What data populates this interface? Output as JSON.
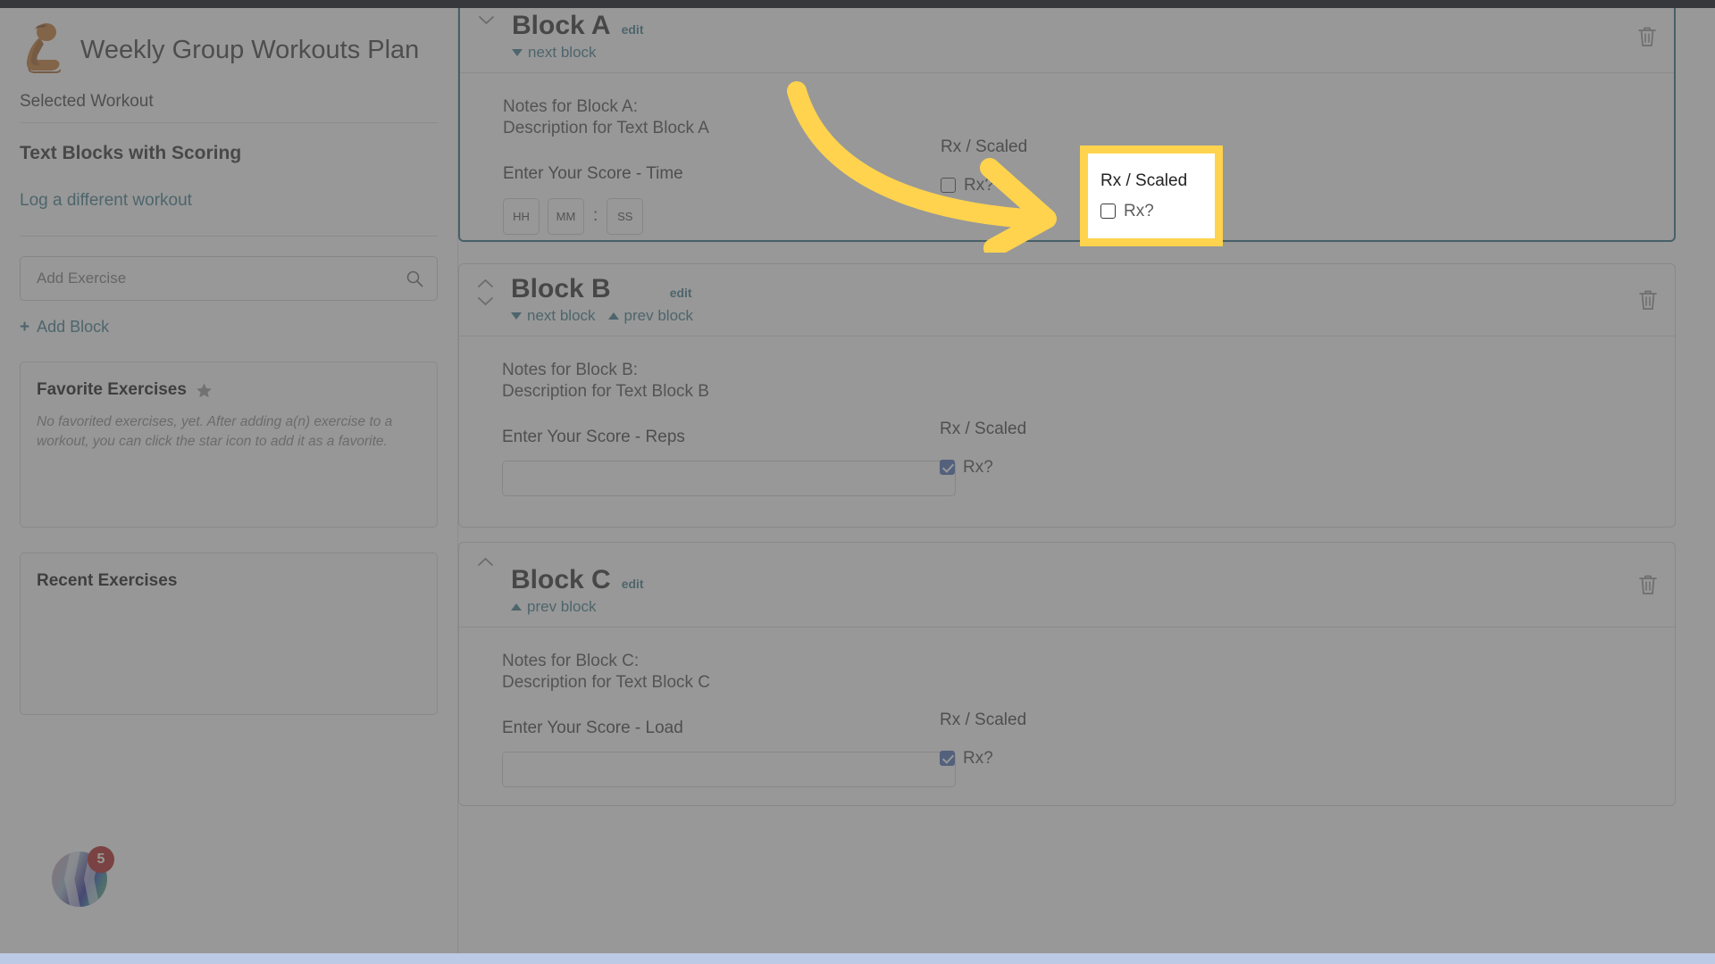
{
  "app": {
    "brand_title": "Weekly Group Workouts Plan",
    "logo_icon": "kneeling-athlete-logo"
  },
  "sidebar": {
    "selected_workout_label": "Selected Workout",
    "workout_name": "Text Blocks with Scoring",
    "log_different_link": "Log a different workout",
    "add_exercise": {
      "placeholder": "Add Exercise",
      "value": "",
      "icon": "search-icon"
    },
    "add_block_link": "Add Block",
    "add_block_icon": "plus-icon",
    "favorites": {
      "title": "Favorite Exercises",
      "icon": "star-icon",
      "empty_text": "No favorited exercises, yet. After adding a(n) exercise to a workout, you can click the star icon to add it as a favorite."
    },
    "recent": {
      "title": "Recent Exercises"
    },
    "float_widget": {
      "badge_count": "5",
      "icon": "wave-logo-icon"
    }
  },
  "main": {
    "blocks": [
      {
        "title": "Block A",
        "edit_label": "edit",
        "next_label": "next block",
        "prev_label": "",
        "notes_label": "Notes for Block A:",
        "notes_text": "Description for Text Block A",
        "score_label": "Enter Your Score - Time",
        "score_type": "time",
        "time_fields": {
          "hh": "HH",
          "mm": "MM",
          "ss": "SS",
          "separator": ":"
        },
        "score_value": "",
        "rx_title": "Rx / Scaled",
        "rx_label": "Rx?",
        "rx_checked": false,
        "delete_icon": "trash-icon",
        "active": true,
        "chevrons": [
          "down"
        ]
      },
      {
        "title": "Block B",
        "edit_label": "edit",
        "next_label": "next block",
        "prev_label": "prev block",
        "notes_label": "Notes for Block B:",
        "notes_text": "Description for Text Block B",
        "score_label": "Enter Your Score - Reps",
        "score_type": "text",
        "score_value": "",
        "rx_title": "Rx / Scaled",
        "rx_label": "Rx?",
        "rx_checked": true,
        "delete_icon": "trash-icon",
        "active": false,
        "chevrons": [
          "up",
          "down"
        ]
      },
      {
        "title": "Block C",
        "edit_label": "edit",
        "next_label": "",
        "prev_label": "prev block",
        "notes_label": "Notes for Block C:",
        "notes_text": "Description for Text Block C",
        "score_label": "Enter Your Score - Load",
        "score_type": "text",
        "score_value": "",
        "rx_title": "Rx / Scaled",
        "rx_label": "Rx?",
        "rx_checked": true,
        "delete_icon": "trash-icon",
        "active": false,
        "chevrons": [
          "up"
        ]
      }
    ]
  },
  "annotation": {
    "highlight": {
      "title": "Rx / Scaled",
      "checkbox_label": "Rx?",
      "checked": false,
      "border_color": "#ffd34e",
      "background": "#ffffff"
    },
    "arrow": {
      "icon": "curved-arrow-icon",
      "color": "#ffd34e"
    }
  },
  "colors": {
    "link": "#3b7a8c",
    "active_border": "#2e6c80",
    "checkbox_checked": "#4a6fb5",
    "highlight": "#ffd34e",
    "badge": "#b01f1f"
  }
}
